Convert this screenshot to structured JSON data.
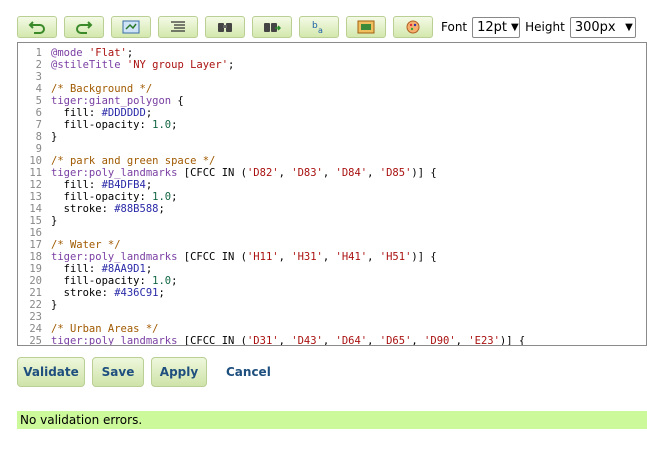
{
  "toolbar": {
    "icons": [
      "undo-icon",
      "redo-icon",
      "go-to-line-icon",
      "auto-format-icon",
      "find-icon",
      "replace-icon",
      "font-size-icon",
      "preview-icon",
      "color-picker-icon"
    ],
    "font_label": "Font",
    "font_value": "12pt",
    "height_label": "Height",
    "height_value": "300px"
  },
  "editor": {
    "lines": [
      {
        "n": "1",
        "tokens": [
          [
            "kw",
            "@mode"
          ],
          [
            "plain",
            " "
          ],
          [
            "str",
            "'Flat'"
          ],
          [
            "plain",
            ";"
          ]
        ]
      },
      {
        "n": "2",
        "tokens": [
          [
            "kw",
            "@stileTitle"
          ],
          [
            "plain",
            " "
          ],
          [
            "str",
            "'NY group Layer'"
          ],
          [
            "plain",
            ";"
          ]
        ]
      },
      {
        "n": "3",
        "tokens": []
      },
      {
        "n": "4",
        "tokens": [
          [
            "comment",
            "/* Background */"
          ]
        ]
      },
      {
        "n": "5",
        "tokens": [
          [
            "kw",
            "tiger:giant_polygon"
          ],
          [
            "plain",
            " {"
          ]
        ]
      },
      {
        "n": "6",
        "tokens": [
          [
            "plain",
            "  fill: "
          ],
          [
            "color",
            "#DDDDDD"
          ],
          [
            "plain",
            ";"
          ]
        ]
      },
      {
        "n": "7",
        "tokens": [
          [
            "plain",
            "  fill-opacity: "
          ],
          [
            "num",
            "1.0"
          ],
          [
            "plain",
            ";"
          ]
        ]
      },
      {
        "n": "8",
        "tokens": [
          [
            "plain",
            "}"
          ]
        ]
      },
      {
        "n": "9",
        "tokens": []
      },
      {
        "n": "10",
        "tokens": [
          [
            "comment",
            "/* park and green space */"
          ]
        ]
      },
      {
        "n": "11",
        "tokens": [
          [
            "kw",
            "tiger:poly_landmarks"
          ],
          [
            "plain",
            " [CFCC IN ("
          ],
          [
            "str",
            "'D82'"
          ],
          [
            "plain",
            ", "
          ],
          [
            "str",
            "'D83'"
          ],
          [
            "plain",
            ", "
          ],
          [
            "str",
            "'D84'"
          ],
          [
            "plain",
            ", "
          ],
          [
            "str",
            "'D85'"
          ],
          [
            "plain",
            ")] {"
          ]
        ]
      },
      {
        "n": "12",
        "tokens": [
          [
            "plain",
            "  fill: "
          ],
          [
            "color",
            "#B4DFB4"
          ],
          [
            "plain",
            ";"
          ]
        ]
      },
      {
        "n": "13",
        "tokens": [
          [
            "plain",
            "  fill-opacity: "
          ],
          [
            "num",
            "1.0"
          ],
          [
            "plain",
            ";"
          ]
        ]
      },
      {
        "n": "14",
        "tokens": [
          [
            "plain",
            "  stroke: "
          ],
          [
            "color",
            "#88B588"
          ],
          [
            "plain",
            ";"
          ]
        ]
      },
      {
        "n": "15",
        "tokens": [
          [
            "plain",
            "}"
          ]
        ]
      },
      {
        "n": "16",
        "tokens": []
      },
      {
        "n": "17",
        "tokens": [
          [
            "comment",
            "/* Water */"
          ]
        ]
      },
      {
        "n": "18",
        "tokens": [
          [
            "kw",
            "tiger:poly_landmarks"
          ],
          [
            "plain",
            " [CFCC IN ("
          ],
          [
            "str",
            "'H11'"
          ],
          [
            "plain",
            ", "
          ],
          [
            "str",
            "'H31'"
          ],
          [
            "plain",
            ", "
          ],
          [
            "str",
            "'H41'"
          ],
          [
            "plain",
            ", "
          ],
          [
            "str",
            "'H51'"
          ],
          [
            "plain",
            ")] {"
          ]
        ]
      },
      {
        "n": "19",
        "tokens": [
          [
            "plain",
            "  fill: "
          ],
          [
            "color",
            "#8AA9D1"
          ],
          [
            "plain",
            ";"
          ]
        ]
      },
      {
        "n": "20",
        "tokens": [
          [
            "plain",
            "  fill-opacity: "
          ],
          [
            "num",
            "1.0"
          ],
          [
            "plain",
            ";"
          ]
        ]
      },
      {
        "n": "21",
        "tokens": [
          [
            "plain",
            "  stroke: "
          ],
          [
            "color",
            "#436C91"
          ],
          [
            "plain",
            ";"
          ]
        ]
      },
      {
        "n": "22",
        "tokens": [
          [
            "plain",
            "}"
          ]
        ]
      },
      {
        "n": "23",
        "tokens": []
      },
      {
        "n": "24",
        "tokens": [
          [
            "comment",
            "/* Urban Areas */"
          ]
        ]
      },
      {
        "n": "25",
        "tokens": [
          [
            "kw",
            "tiger:poly_landmarks"
          ],
          [
            "plain",
            " [CFCC IN ("
          ],
          [
            "str",
            "'D31'"
          ],
          [
            "plain",
            ", "
          ],
          [
            "str",
            "'D43'"
          ],
          [
            "plain",
            ", "
          ],
          [
            "str",
            "'D64'"
          ],
          [
            "plain",
            ", "
          ],
          [
            "str",
            "'D65'"
          ],
          [
            "plain",
            ", "
          ],
          [
            "str",
            "'D90'"
          ],
          [
            "plain",
            ", "
          ],
          [
            "str",
            "'E23'"
          ],
          [
            "plain",
            ")] {"
          ]
        ]
      }
    ]
  },
  "actions": {
    "validate_label": "Validate",
    "save_label": "Save",
    "apply_label": "Apply",
    "cancel_label": "Cancel"
  },
  "status": {
    "message": "No validation errors."
  },
  "colors": {
    "button_bg": "#d3e8ad",
    "button_text": "#1e4f7e",
    "status_bg": "#ccf99a"
  }
}
